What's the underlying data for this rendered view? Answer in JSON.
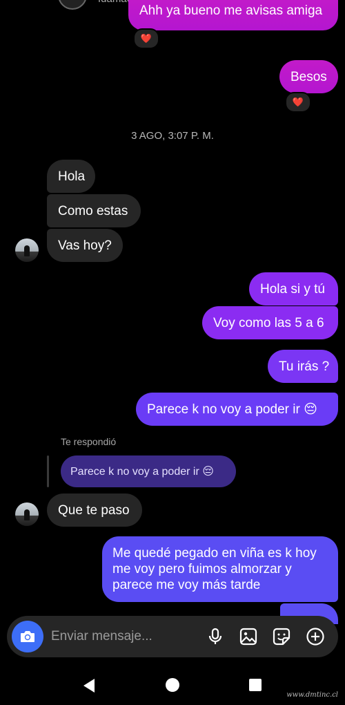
{
  "header": {
    "username": "fdamacarena"
  },
  "messages": {
    "m0": "Ahh ya bueno me avisas amiga",
    "m1": "Besos",
    "timestamp": "3 AGO, 3:07 P. M.",
    "m2": "Hola",
    "m3": "Como estas",
    "m4": "Vas hoy?",
    "m5": "Hola si y tú",
    "m6": "Voy como las 5 a 6",
    "m7": "Tu irás ?",
    "m8": "Parece k no voy a poder ir 😔",
    "reply_label": "Te respondió",
    "reply_quote": "Parece k no voy a poder ir 😔",
    "m9": "Que te paso",
    "m10_line1": "Me quedé pegado en viña es k hoy",
    "m10_line2": "me voy pero fuimos almorzar y",
    "m10_line3": "parece me voy más tarde"
  },
  "reactions": {
    "r1": "❤️",
    "r2": "❤️"
  },
  "composer": {
    "placeholder": "Enviar mensaje..."
  },
  "icons": {
    "camera": "camera-icon",
    "mic": "microphone-icon",
    "gallery": "image-icon",
    "sticker": "sticker-icon",
    "plus": "plus-circle-icon"
  },
  "watermark": "www.dmtinc.cl",
  "colors": {
    "background": "#000000",
    "received_bubble": "#262626",
    "sent_pink": "#c21ac9",
    "sent_purple": "#8b2cf2",
    "sent_blue": "#5a4df3",
    "camera_button": "#3d6ef7"
  }
}
